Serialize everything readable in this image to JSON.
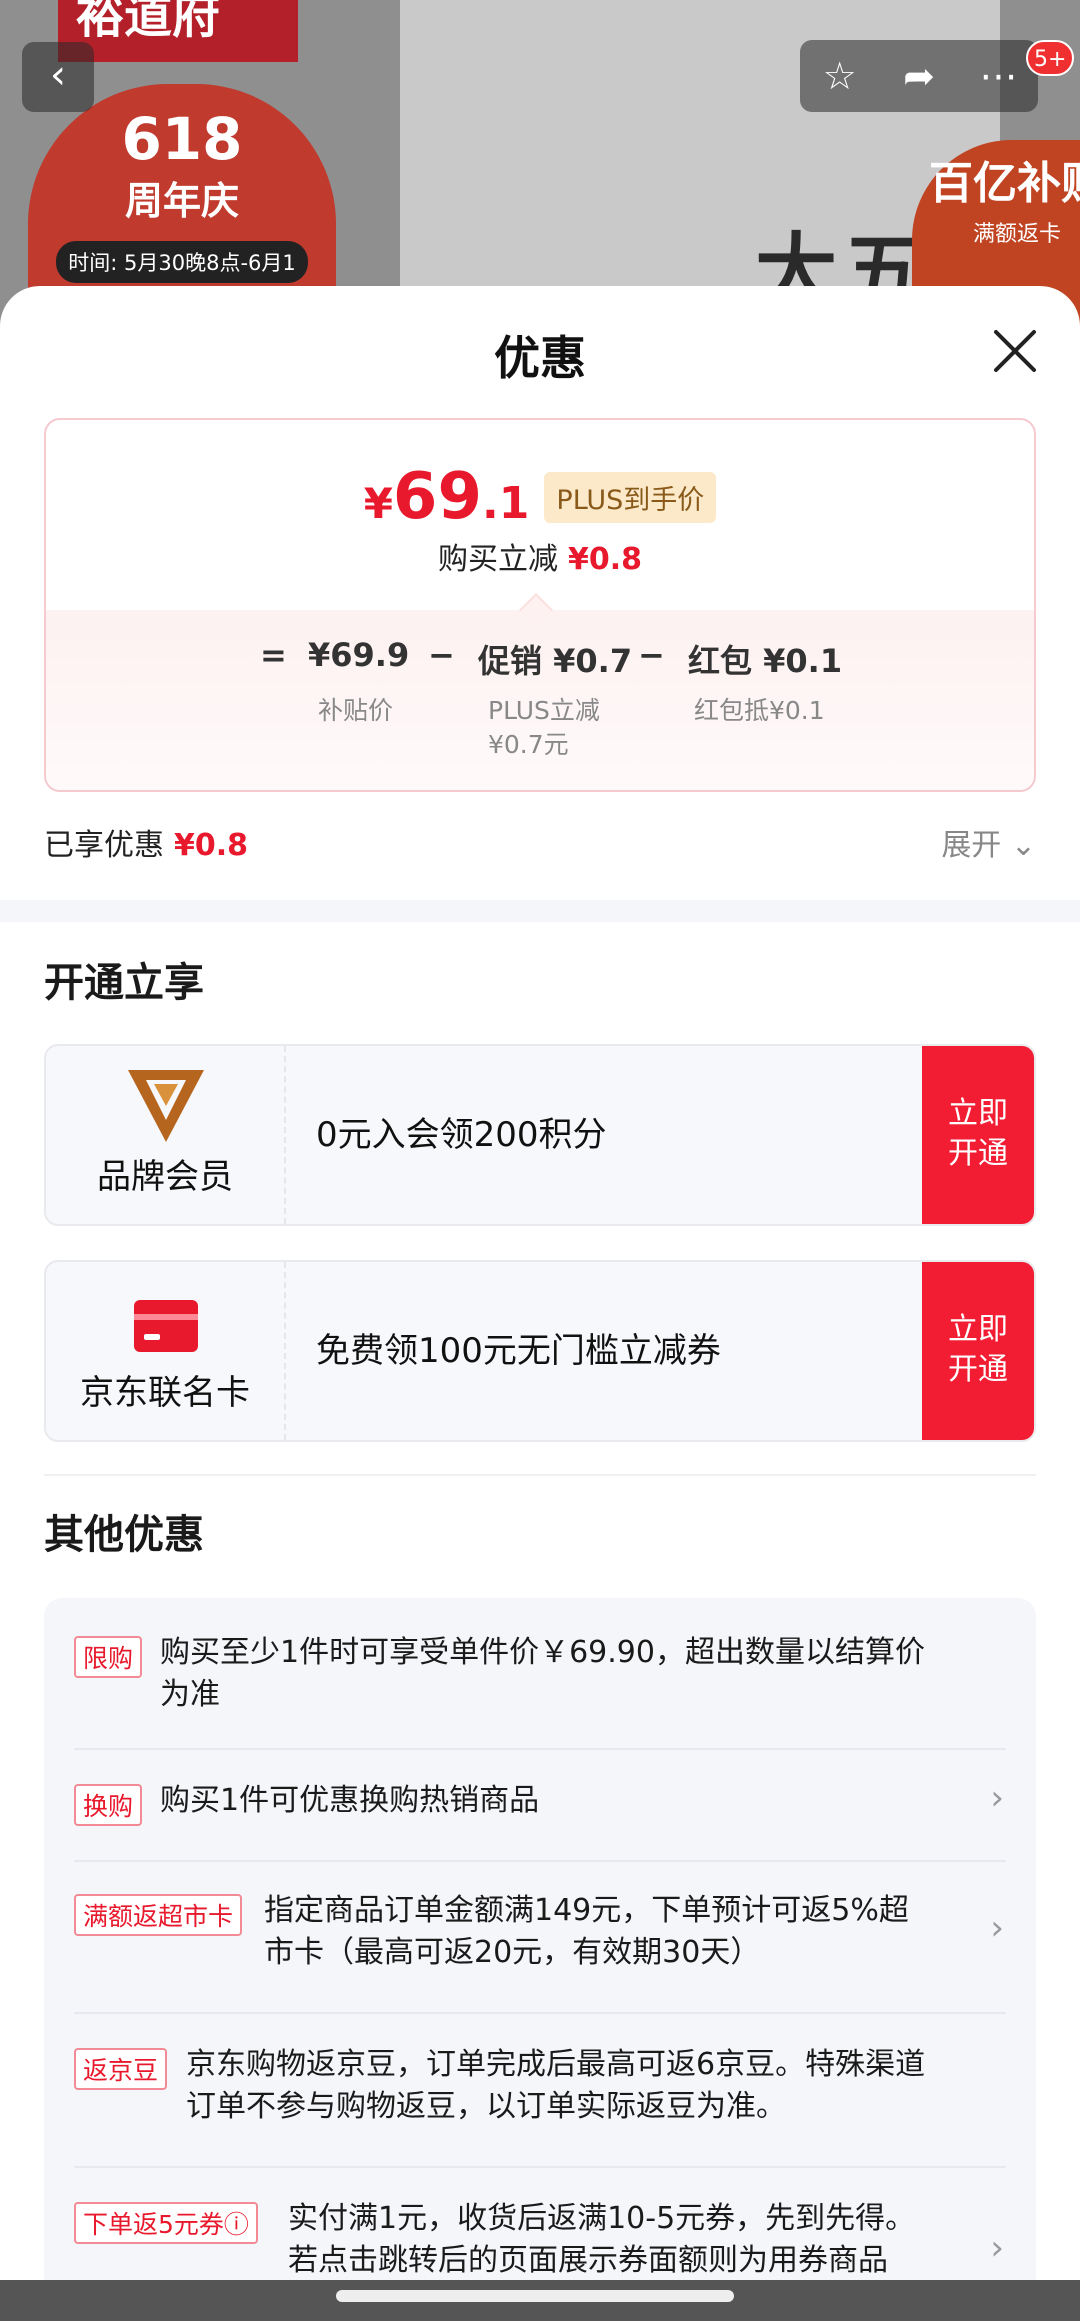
{
  "background": {
    "store_header": "裕道府",
    "promo_big": "618",
    "promo_sub": "周年庆",
    "promo_time": "时间: 5月30晚8点-6月1",
    "product_text": "大五",
    "subsidy_title": "百亿补贴",
    "subsidy_sub": "满额返卡",
    "message_badge": "5+"
  },
  "sheet": {
    "title": "优惠"
  },
  "price_card": {
    "currency": "¥",
    "price_int": "69",
    "price_dec": ".1",
    "plus_badge": "PLUS到手价",
    "reduce_label": "购买立减",
    "reduce_value": "¥0.8",
    "formula": {
      "eq": "=",
      "subsidy_price": "¥69.9",
      "subsidy_label": "补贴价",
      "minus1": "−",
      "promo": "促销 ¥0.7",
      "promo_label_1": "PLUS立减",
      "promo_label_2": "¥0.7元",
      "minus2": "−",
      "hongbao": "红包 ¥0.1",
      "hongbao_label": "红包抵¥0.1"
    }
  },
  "enjoyed": {
    "label": "已享优惠",
    "value": "¥0.8",
    "expand_label": "展开"
  },
  "open_section": {
    "title": "开通立享",
    "cards": [
      {
        "label": "品牌会员",
        "desc": "0元入会领200积分",
        "btn_line1": "立即",
        "btn_line2": "开通"
      },
      {
        "label": "京东联名卡",
        "desc": "免费领100元无门槛立减券",
        "btn_line1": "立即",
        "btn_line2": "开通"
      }
    ]
  },
  "other_section": {
    "title": "其他优惠",
    "items": [
      {
        "tag": "限购",
        "line1": "购买至少1件时可享受单件价￥69.90，超出数量以结算价",
        "line2": "为准"
      },
      {
        "tag": "换购",
        "line1": "购买1件可优惠换购热销商品",
        "line2": ""
      },
      {
        "tag": "满额返超市卡",
        "line1": "指定商品订单金额满149元，下单预计可返5%超",
        "line2": "市卡（最高可返20元，有效期30天）"
      },
      {
        "tag": "返京豆",
        "line1": "京东购物返京豆，订单完成后最高可返6京豆。特殊渠道",
        "line2": "订单不参与购物返豆，以订单实际返豆为准。"
      },
      {
        "tag": "下单返5元券ⓘ",
        "line1": "实付满1元，收货后返满10-5元券，先到先得。",
        "line2": "若点击跳转后的页面展示券面额则为用券商品"
      }
    ]
  },
  "colors": {
    "accent_red": "#e8192c",
    "button_red": "#f21d33"
  }
}
